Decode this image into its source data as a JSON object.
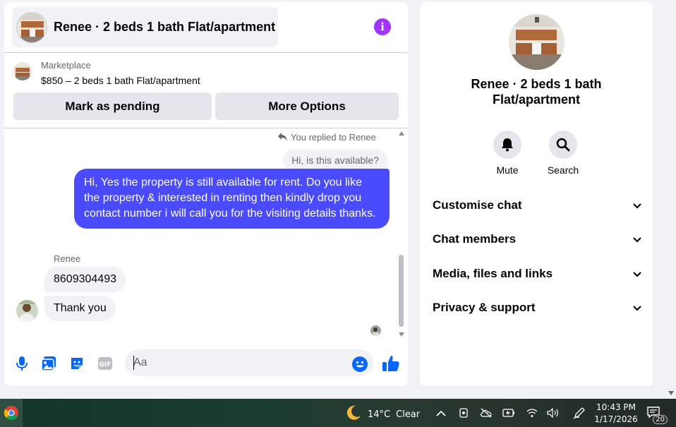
{
  "chat": {
    "title": "Renee · 2 beds 1 bath Flat/apartment",
    "listing": {
      "source": "Marketplace",
      "price_title": "$850 – 2 beds 1 bath Flat/apartment",
      "mark_pending_label": "Mark as pending",
      "more_options_label": "More Options"
    },
    "messages": {
      "replied_note": "You replied to Renee",
      "quoted_text": "Hi, is this available?",
      "outgoing_text": "Hi, Yes the property is still available for rent. Do you like the property & interested in renting then kindly drop you contact number i will call you for the visiting details thanks.",
      "sender_name": "Renee",
      "incoming": [
        "8609304493",
        "Thank you"
      ]
    },
    "composer": {
      "placeholder": "Aa"
    }
  },
  "info_panel": {
    "name": "Renee · 2 beds 1 bath Flat/apartment",
    "actions": [
      {
        "label": "Mute",
        "icon": "bell-icon"
      },
      {
        "label": "Search",
        "icon": "search-icon"
      }
    ],
    "sections": [
      "Customise chat",
      "Chat members",
      "Media, files and links",
      "Privacy & support"
    ]
  },
  "taskbar": {
    "weather_temp": "14°C",
    "weather_desc": "Clear",
    "time": "10:43 PM",
    "date": "1/17/2026",
    "notification_count": "20"
  },
  "colors": {
    "outgoing_bubble": "#4a4bff",
    "accent_blue": "#0866ff",
    "info_purple": "#a033ff"
  }
}
